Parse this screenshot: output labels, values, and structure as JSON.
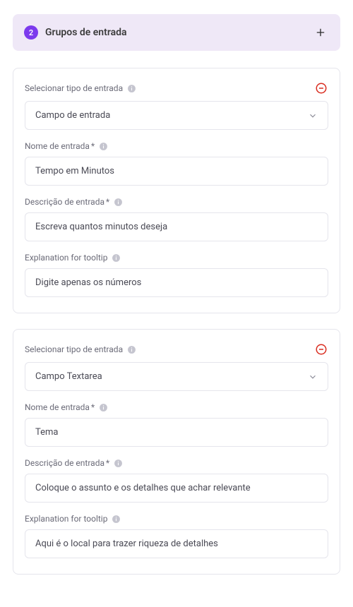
{
  "header": {
    "step": "2",
    "title": "Grupos de entrada"
  },
  "labels": {
    "selectType": "Selecionar tipo de entrada",
    "inputName": "Nome de entrada",
    "inputDesc": "Descrição de entrada",
    "tooltipExp": "Explanation for tooltip",
    "required": "*"
  },
  "groups": [
    {
      "type": "Campo de entrada",
      "name": "Tempo em Minutos",
      "desc": "Escreva quantos minutos deseja",
      "tooltip": "Digite apenas os números"
    },
    {
      "type": "Campo Textarea",
      "name": "Tema",
      "desc": "Coloque o assunto e os detalhes que achar relevante",
      "tooltip": "Aqui é o local para trazer riqueza de detalhes"
    }
  ]
}
